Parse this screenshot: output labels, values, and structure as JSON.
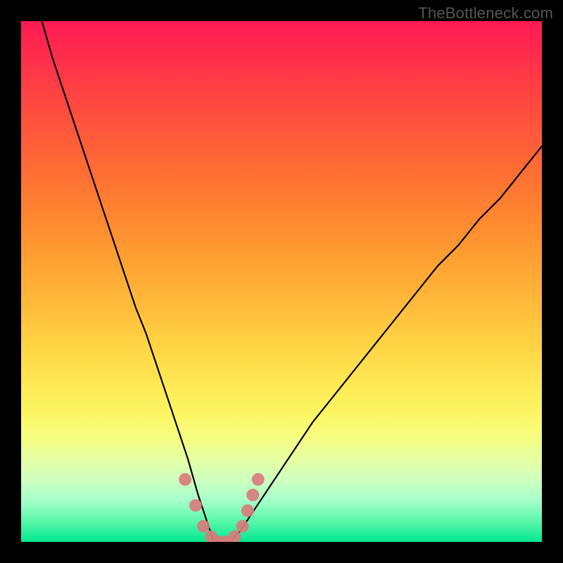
{
  "watermark": "TheBottleneck.com",
  "chart_data": {
    "type": "line",
    "title": "",
    "xlabel": "",
    "ylabel": "",
    "xlim": [
      0,
      100
    ],
    "ylim": [
      0,
      100
    ],
    "series": [
      {
        "name": "bottleneck-curve",
        "x": [
          4,
          6,
          8,
          10,
          12,
          14,
          16,
          18,
          20,
          22,
          24,
          26,
          28,
          30,
          32,
          34,
          35,
          36,
          37,
          38,
          40,
          42,
          44,
          46,
          48,
          52,
          56,
          60,
          64,
          68,
          72,
          76,
          80,
          84,
          88,
          92,
          96,
          100
        ],
        "y": [
          100,
          93,
          87,
          81,
          75,
          69,
          63,
          57,
          51,
          45,
          40,
          34,
          28,
          22,
          16,
          9,
          6,
          3,
          0,
          0,
          0,
          2,
          5,
          8,
          11,
          17,
          23,
          28,
          33,
          38,
          43,
          48,
          53,
          57,
          62,
          66,
          71,
          76
        ]
      },
      {
        "name": "datapoints",
        "x": [
          31.5,
          33.5,
          35.0,
          36.5,
          38.0,
          39.5,
          41.0,
          42.5,
          43.5,
          44.5,
          45.5
        ],
        "y": [
          12,
          7,
          3,
          1,
          0,
          0,
          1,
          3,
          6,
          9,
          12
        ]
      }
    ],
    "gradient": {
      "description": "vertical red-to-green heat gradient",
      "stops": [
        {
          "pos": 0,
          "color": "#ff1a54"
        },
        {
          "pos": 50,
          "color": "#ffb93a"
        },
        {
          "pos": 80,
          "color": "#f5fd80"
        },
        {
          "pos": 100,
          "color": "#00e890"
        }
      ]
    }
  }
}
